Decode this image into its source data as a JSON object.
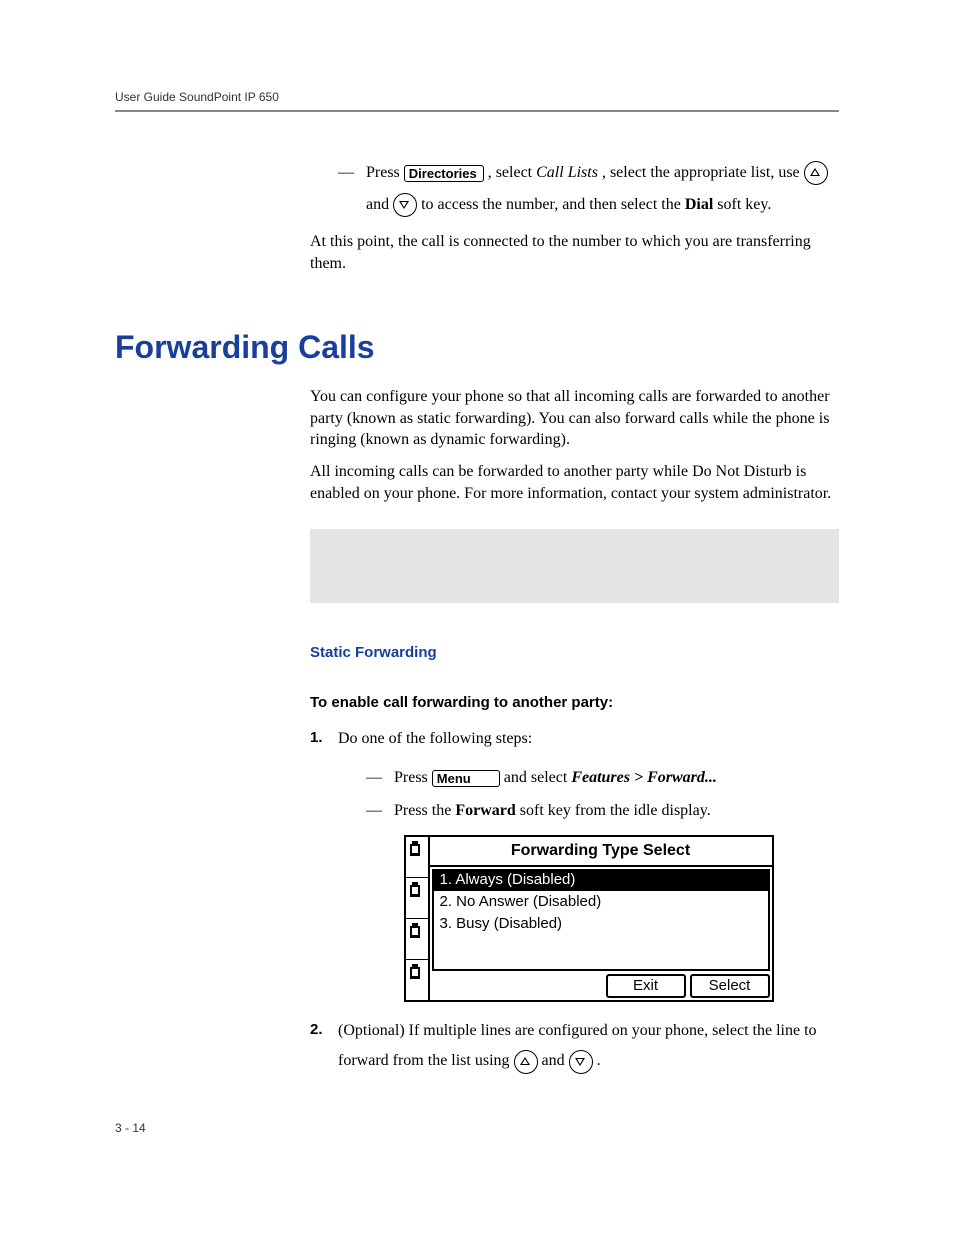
{
  "header": "User Guide SoundPoint IP 650",
  "page_num": "3 - 14",
  "keys": {
    "directories": "Directories",
    "menu": "Menu"
  },
  "top_block": {
    "press": "Press ",
    "after_dir_1": " , select ",
    "call_lists": "Call Lists",
    "after_dir_2": ", select the appropriate list, use ",
    "and": " and ",
    "after_arrows": " to access the number, and then select the ",
    "dial": "Dial",
    "after_dial": " soft key.",
    "conn_para": "At this point, the call is connected to the number to which you are transferring them."
  },
  "section_title": "Forwarding Calls",
  "fwd_p1": "You can configure your phone so that all incoming calls are forwarded to another party (known as static forwarding). You can also forward calls while the phone is ringing (known as dynamic forwarding).",
  "fwd_p2": "All incoming calls can be forwarded to another party while Do Not Disturb is enabled on your phone. For more information, contact your system administrator.",
  "static_head": "Static Forwarding",
  "enable_head": "To enable call forwarding to another party:",
  "step1": {
    "intro": "Do one of the following steps:",
    "a_press": "Press ",
    "a_after": " and select ",
    "a_path": "Features > Forward...",
    "b_pre": "Press the ",
    "b_key": "Forward",
    "b_post": " soft key from the idle display."
  },
  "lcd": {
    "title": "Forwarding Type Select",
    "rows": [
      "1. Always (Disabled)",
      "2. No Answer (Disabled)",
      "3. Busy (Disabled)"
    ],
    "soft": [
      "Exit",
      "Select"
    ]
  },
  "step2": {
    "pre": "(Optional) If multiple lines are configured on your phone, select the line to forward from the list using ",
    "and": " and ",
    "post": "."
  }
}
